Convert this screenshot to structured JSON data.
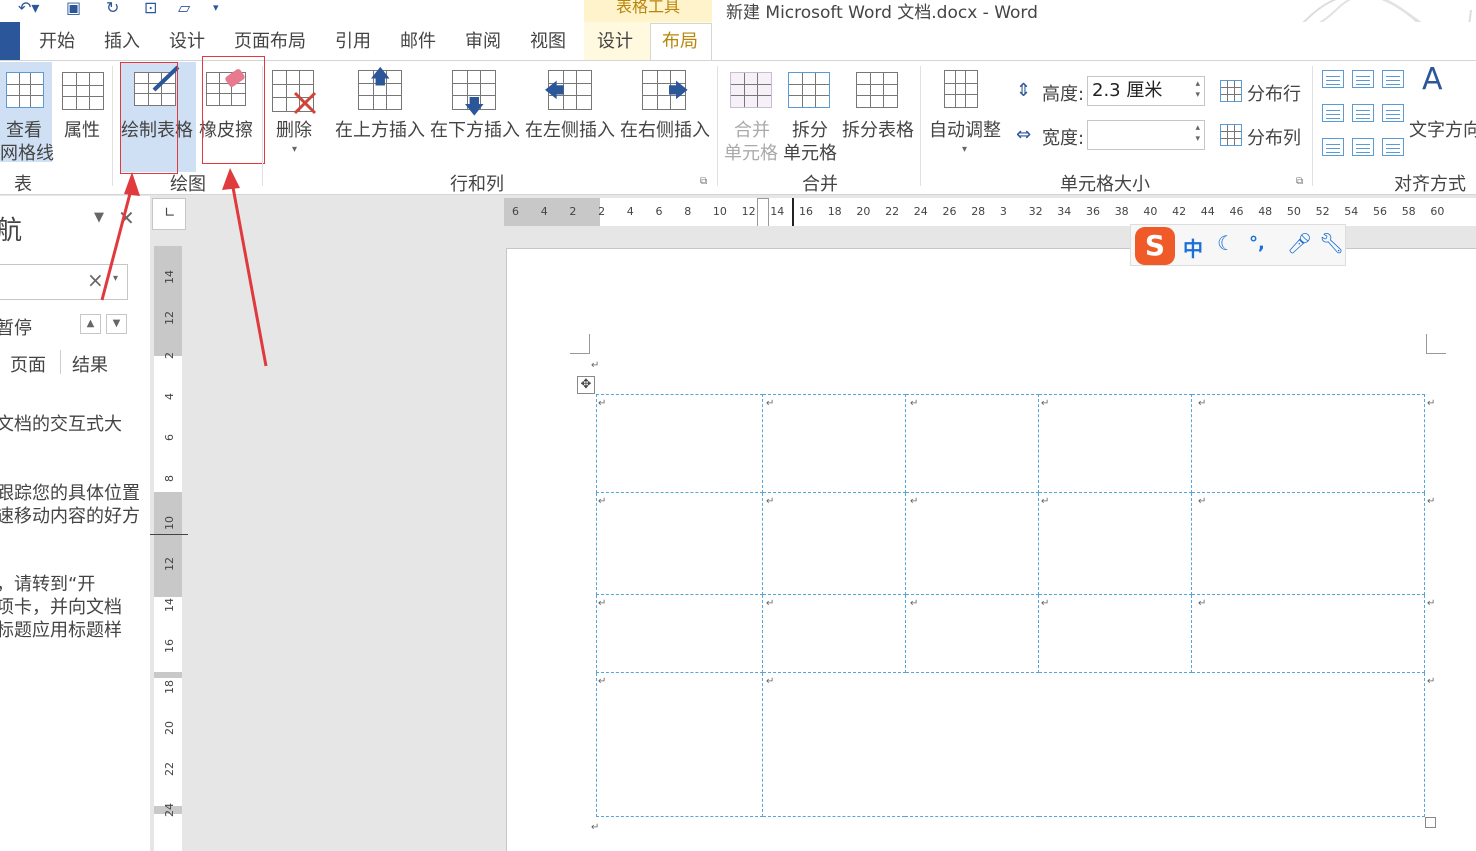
{
  "title_bar": {
    "context_tool": "表格工具",
    "document_title": "新建 Microsoft Word 文档.docx - Word"
  },
  "tabs": [
    "开始",
    "插入",
    "设计",
    "页面布局",
    "引用",
    "邮件",
    "审阅",
    "视图",
    "设计",
    "布局"
  ],
  "ribbon": {
    "table_group": {
      "label": "表",
      "buttons": [
        "查看",
        "网格线",
        "属性"
      ]
    },
    "draw_group": {
      "label": "绘图",
      "draw_table": "绘制表格",
      "eraser": "橡皮擦"
    },
    "rows_cols_group": {
      "label": "行和列",
      "delete": "删除",
      "insert_above": "在上方插入",
      "insert_below": "在下方插入",
      "insert_left": "在左侧插入",
      "insert_right": "在右侧插入"
    },
    "merge_group": {
      "label": "合并",
      "merge_cells": [
        "合并",
        "单元格"
      ],
      "split_cells": [
        "拆分",
        "单元格"
      ],
      "split_table": "拆分表格"
    },
    "cell_size_group": {
      "label": "单元格大小",
      "autofit": "自动调整",
      "height_label": "高度:",
      "height_value": "2.3 厘米",
      "width_label": "宽度:",
      "width_value": "",
      "distribute_rows": "分布行",
      "distribute_cols": "分布列"
    },
    "alignment_group": {
      "label": "对齐方式",
      "text_direction": "文字方向"
    }
  },
  "nav_pane": {
    "title_fragment": "航",
    "search_clear": "×",
    "paused": "暂停",
    "tab_pages": "页面",
    "tab_results": "结果",
    "paragraphs": [
      [
        "文档的交互式大"
      ],
      [
        "跟踪您的具体位置",
        "速移动内容的好方"
      ],
      [
        "，请转到“开",
        "项卡，并向文档",
        "标题应用标题样"
      ]
    ]
  },
  "ruler": {
    "h_ticks": [
      "6",
      "4",
      "2",
      "2",
      "4",
      "6",
      "8",
      "10",
      "12",
      "14",
      "16",
      "18",
      "20",
      "22",
      "24",
      "26",
      "28",
      "3",
      "32",
      "34",
      "36",
      "38",
      "40",
      "42",
      "44",
      "46",
      "48",
      "50",
      "52",
      "54",
      "56",
      "58",
      "60"
    ],
    "v_ticks": [
      "14",
      "12",
      "2",
      "4",
      "6",
      "8",
      "10",
      "12",
      "14",
      "16",
      "18",
      "20",
      "22",
      "24"
    ]
  },
  "ime_toolbar": {
    "mode": "中",
    "punct": "°,",
    "logo": "S"
  }
}
